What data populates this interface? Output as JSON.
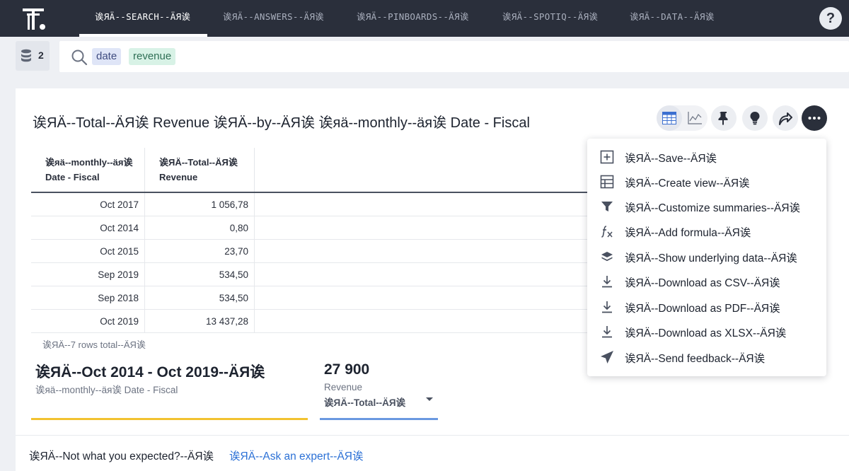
{
  "nav": {
    "tabs": [
      {
        "label": "诶ЯÄ--SEARCH--ÄЯ诶",
        "active": true
      },
      {
        "label": "诶ЯÄ--ANSWERS--ÄЯ诶",
        "active": false
      },
      {
        "label": "诶ЯÄ--PINBOARDS--ÄЯ诶",
        "active": false
      },
      {
        "label": "诶ЯÄ--SPOTIQ--ÄЯ诶",
        "active": false
      },
      {
        "label": "诶ЯÄ--DATA--ÄЯ诶",
        "active": false
      }
    ],
    "help_label": "?"
  },
  "search": {
    "source_count": "2",
    "chips": [
      "date",
      "revenue"
    ]
  },
  "answer": {
    "title": "诶ЯÄ--Total--ÄЯ诶 Revenue 诶ЯÄ--by--ÄЯ诶 诶яä--monthly--äя诶 Date - Fiscal",
    "toolbar_icons": [
      "table-icon",
      "line-chart-icon",
      "pin-icon",
      "lightbulb-icon",
      "share-icon",
      "more-icon"
    ]
  },
  "table": {
    "columns": [
      "诶яä--monthly--äя诶 Date - Fiscal",
      "诶ЯÄ--Total--ÄЯ诶 Revenue"
    ],
    "rows": [
      [
        "Oct 2017",
        "1 056,78"
      ],
      [
        "Oct 2014",
        "0,80"
      ],
      [
        "Oct 2015",
        "23,70"
      ],
      [
        "Sep 2019",
        "534,50"
      ],
      [
        "Sep 2018",
        "534,50"
      ],
      [
        "Oct 2019",
        "13 437,28"
      ]
    ],
    "rows_total": "诶ЯÄ--7 rows total--ÄЯ诶"
  },
  "summary": {
    "date_range": "诶ЯÄ--Oct 2014 - Oct 2019--ÄЯ诶",
    "date_label": "诶яä--monthly--äя诶 Date - Fiscal",
    "value": "27 900",
    "measure_name": "Revenue",
    "aggregation": "诶ЯÄ--Total--ÄЯ诶",
    "colors": {
      "date_bar": "#f2c230",
      "value_bar": "#6a98e0"
    }
  },
  "footer": {
    "question": "诶ЯÄ--Not what you expected?--ÄЯ诶",
    "link": "诶ЯÄ--Ask an expert--ÄЯ诶"
  },
  "menu": {
    "items": [
      {
        "label": "诶ЯÄ--Save--ÄЯ诶",
        "icon": "plus-square-icon"
      },
      {
        "label": "诶ЯÄ--Create view--ÄЯ诶",
        "icon": "table-grid-icon"
      },
      {
        "label": "诶ЯÄ--Customize summaries--ÄЯ诶",
        "icon": "filter-icon"
      },
      {
        "label": "诶ЯÄ--Add formula--ÄЯ诶",
        "icon": "formula-icon"
      },
      {
        "label": "诶ЯÄ--Show underlying data--ÄЯ诶",
        "icon": "layers-icon"
      },
      {
        "label": "诶ЯÄ--Download as CSV--ÄЯ诶",
        "icon": "download-icon"
      },
      {
        "label": "诶ЯÄ--Download as PDF--ÄЯ诶",
        "icon": "download-icon"
      },
      {
        "label": "诶ЯÄ--Download as XLSX--ÄЯ诶",
        "icon": "download-icon"
      },
      {
        "label": "诶ЯÄ--Send feedback--ÄЯ诶",
        "icon": "send-icon"
      }
    ]
  }
}
